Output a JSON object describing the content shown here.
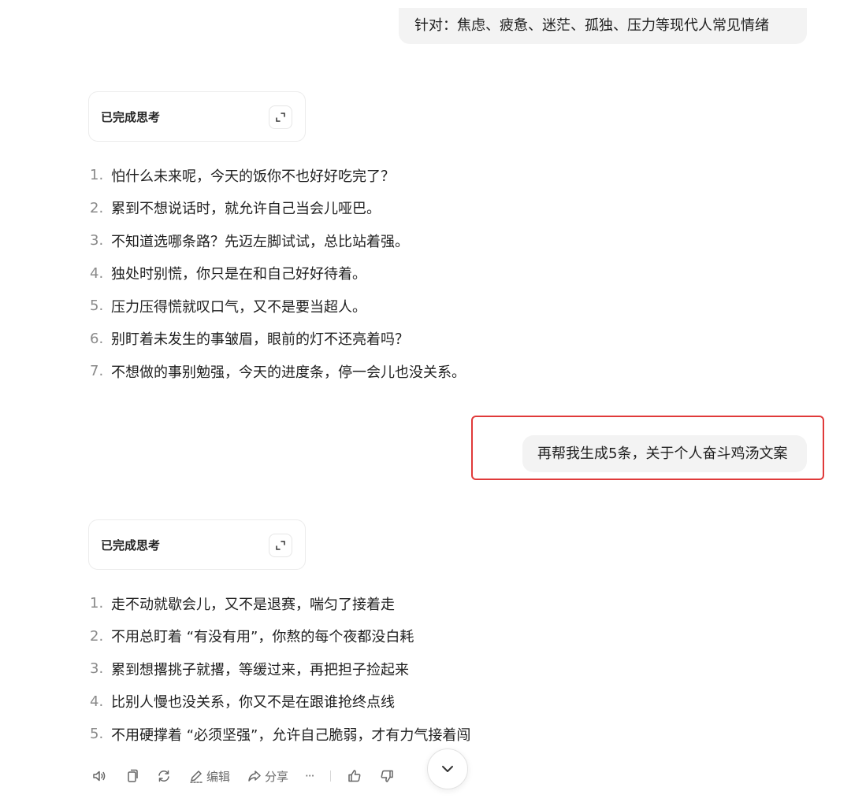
{
  "messages": {
    "user_top": "针对：焦虑、疲惫、迷茫、孤独、压力等现代人常见情绪",
    "user_mid": "再帮我生成5条，关于个人奋斗鸡汤文案"
  },
  "thinking": {
    "label_1": "已完成思考",
    "label_2": "已完成思考"
  },
  "reply_1": {
    "items": [
      {
        "num": "1.",
        "text": "怕什么未来呢，今天的饭你不也好好吃完了？"
      },
      {
        "num": "2.",
        "text": "累到不想说话时，就允许自己当会儿哑巴。"
      },
      {
        "num": "3.",
        "text": "不知道选哪条路？先迈左脚试试，总比站着强。"
      },
      {
        "num": "4.",
        "text": "独处时别慌，你只是在和自己好好待着。"
      },
      {
        "num": "5.",
        "text": "压力压得慌就叹口气，又不是要当超人。"
      },
      {
        "num": "6.",
        "text": "别盯着未发生的事皱眉，眼前的灯不还亮着吗？"
      },
      {
        "num": "7.",
        "text": "不想做的事别勉强，今天的进度条，停一会儿也没关系。"
      }
    ]
  },
  "reply_2": {
    "items": [
      {
        "num": "1.",
        "text": "走不动就歇会儿，又不是退赛，喘匀了接着走"
      },
      {
        "num": "2.",
        "text": "不用总盯着 “有没有用”，你熬的每个夜都没白耗"
      },
      {
        "num": "3.",
        "text": "累到想撂挑子就撂，等缓过来，再把担子捡起来"
      },
      {
        "num": "4.",
        "text": "比别人慢也没关系，你又不是在跟谁抢终点线"
      },
      {
        "num": "5.",
        "text": "不用硬撑着 “必须坚强”，允许自己脆弱，才有力气接着闯"
      }
    ]
  },
  "actions": {
    "edit_label": "编辑",
    "share_label": "分享",
    "more_label": "···"
  },
  "colors": {
    "highlight": "#e03a3a",
    "bubble_bg": "#f3f3f3"
  },
  "icons": [
    "speaker-icon",
    "copy-icon",
    "regenerate-icon",
    "edit-icon",
    "share-icon",
    "more-icon",
    "thumbs-up-icon",
    "thumbs-down-icon",
    "expand-icon",
    "chevron-down-icon"
  ]
}
